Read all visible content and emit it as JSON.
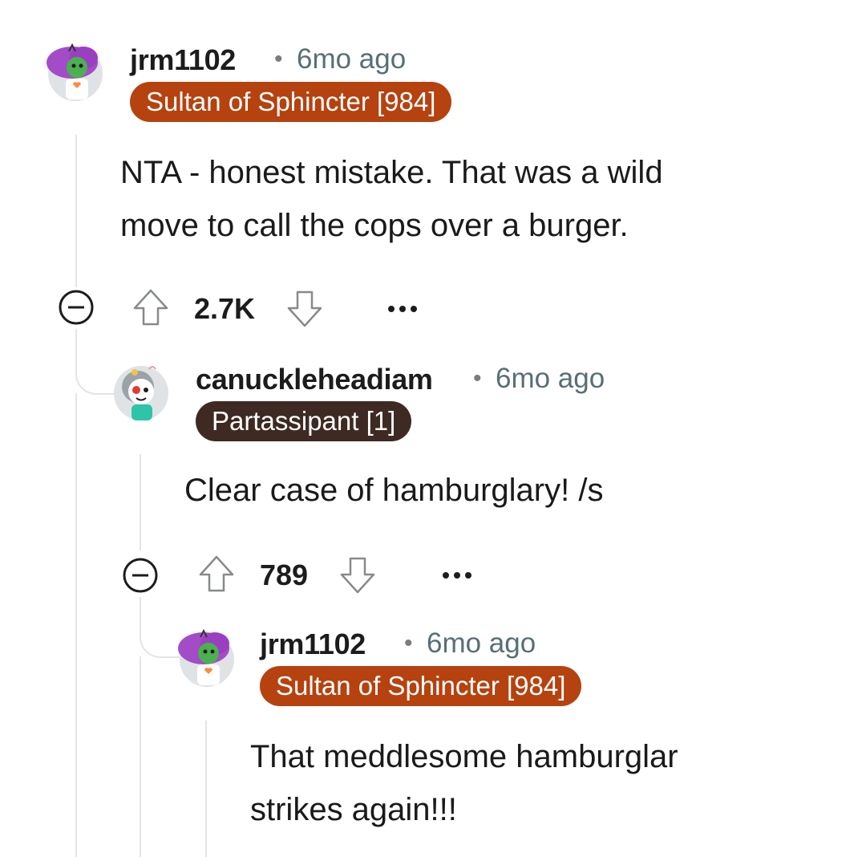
{
  "comments": [
    {
      "username": "jrm1102",
      "separator": "•",
      "time": "6mo ago",
      "flair": "Sultan of Sphincter [984]",
      "body_lines": [
        "NTA - honest mistake. That was a wild",
        "move to call the cops over a burger."
      ],
      "score": "2.7K",
      "flair_color": "#b5420f"
    },
    {
      "username": "canuckleheadiam",
      "separator": "•",
      "time": "6mo ago",
      "flair": "Partassipant [1]",
      "body_lines": [
        "Clear case of hamburglary! /s"
      ],
      "score": "789",
      "flair_color": "#3e2a22"
    },
    {
      "username": "jrm1102",
      "separator": "•",
      "time": "6mo ago",
      "flair": "Sultan of Sphincter [984]",
      "body_lines": [
        "That meddlesome hamburglar",
        "strikes again!!!"
      ],
      "flair_color": "#b5420f"
    }
  ],
  "icons": {
    "collapse": "minus-circle-icon",
    "upvote": "arrow-up-outline-icon",
    "downvote": "arrow-down-outline-icon",
    "more": "ellipsis-icon"
  },
  "colors": {
    "thread_line": "#e2e4e6",
    "meta_text": "#576f76"
  }
}
